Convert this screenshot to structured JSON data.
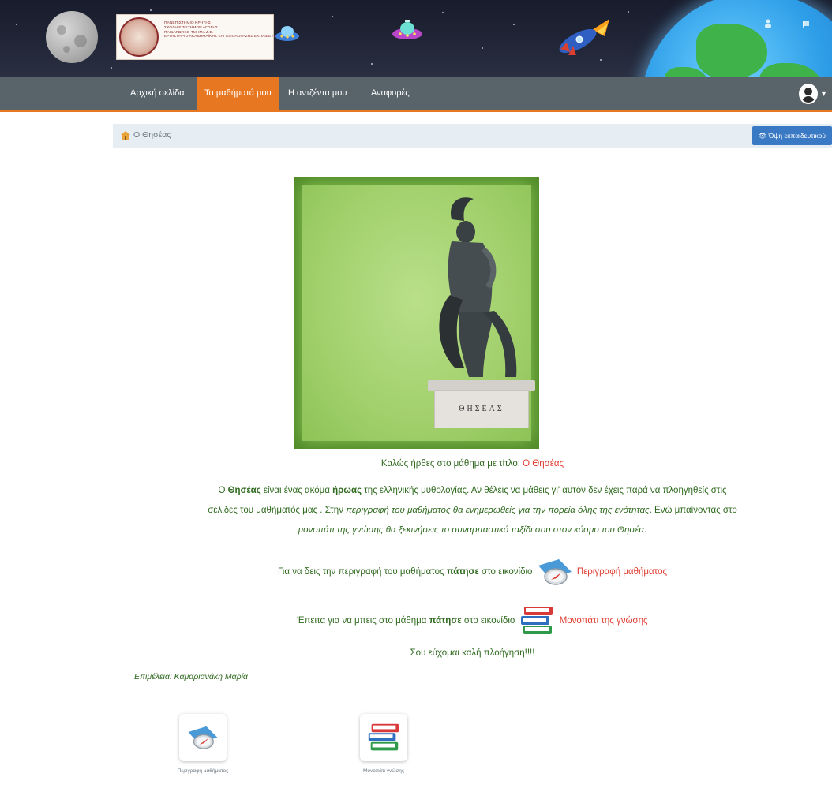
{
  "banner": {
    "logo_lines": "ΠΑΝΕΠΙΣΤΗΜΙΟ ΚΡΗΤΗΣ\nΣΧΟΛΗ ΕΠΙΣΤΗΜΩΝ ΑΓΩΓΗΣ\nΠΑΙΔΑΓΩΓΙΚΟ ΤΜΗΜΑ Δ.Ε.\nΕΡΓΑΣΤΗΡΙΟ ΑΚΑΔΗΜΑΪΚΗΣ ΚΑΙ ΑΞΙΟΛΟΓΗΣΗΣ ΕΚΠΑΙΔΕΥΣΗΣ"
  },
  "nav": {
    "items": [
      {
        "label": "Αρχική σελίδα",
        "active": false
      },
      {
        "label": "Τα μαθήματά μου",
        "active": true
      },
      {
        "label": "Η αντζέντα μου",
        "active": false
      },
      {
        "label": "Αναφορές",
        "active": false
      }
    ],
    "user_icon": "user-circle-icon",
    "accent": "#e87722"
  },
  "breadcrumb": {
    "course": "Ο Θησέας",
    "teacher_view": "👁 Όψη εκπαιδευτικού"
  },
  "hero": {
    "base_inscription": "ΘΗΣΕΑΣ"
  },
  "content": {
    "welcome_prefix": "Καλώς ήρθες στο μάθημα με τίτλο: ",
    "welcome_title": "Ο Θησέας",
    "p1_a": "Ο ",
    "p1_name": "Θησέας",
    "p1_b": " είναι ένας ακόμα ",
    "p1_hero": "ήρωας",
    "p1_c": " της ελληνικής μυθολογίας. Αν θέλεις να μάθεις γι' αυτόν δεν έχεις παρά να πλοηγηθείς στις",
    "p2_a": "σελίδες του μαθήματός μας . Στην ",
    "p2_i1": "περιγραφή του μαθήματος θα ενημερωθείς για την πορεία όλης της ενότητας",
    "p2_b": ". Ενώ μπαίνοντας στο",
    "p3_i": "μονοπάτι της γνώσης θα ξεκινήσεις το συναρπαστικό ταξίδι σου στον κόσμο του Θησέα",
    "p3_end": ".",
    "desc_line_a": "Για να δεις την περιγραφή του μαθήματος ",
    "desc_line_bold": "πάτησε",
    "desc_line_b": " στο εικονίδιο ",
    "desc_link": "Περιγραφή μαθήματος",
    "path_line_a": "Έπειτα για να μπεις στο μάθημα ",
    "path_line_bold": "πάτησε",
    "path_line_b": " στο εικονίδιο ",
    "path_link": "Μονοπάτι της γνώσης",
    "farewell": "Σου εύχομαι καλή πλοήγηση!!!!",
    "credit": "Επιμέλεια: Καμαριανάκη Μαρία"
  },
  "tiles": [
    {
      "caption": "Περιγραφή μαθήματος",
      "icon": "compass-icon"
    },
    {
      "caption": "Μονοπάτι γνώσης",
      "icon": "books-icon"
    }
  ]
}
